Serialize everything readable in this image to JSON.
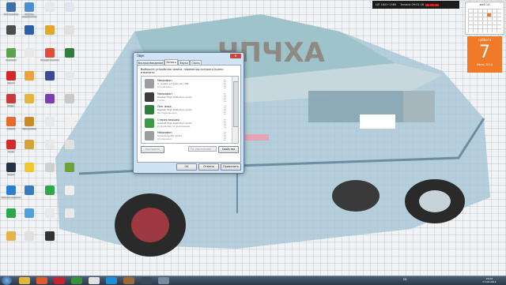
{
  "desktop_icons": [
    {
      "label": "Компьютер",
      "color": "#3d6fa8"
    },
    {
      "label": "Панель управления",
      "color": "#4a8fd0"
    },
    {
      "label": "",
      "color": "#e8e8e8"
    },
    {
      "label": "",
      "color": "#dfe6ee"
    },
    {
      "label": "",
      "color": "#4d4d4d"
    },
    {
      "label": "",
      "color": "#2d5fa8"
    },
    {
      "label": "",
      "color": "#e2a62a"
    },
    {
      "label": "",
      "color": "#e0e0e0"
    },
    {
      "label": "Корзина",
      "color": "#5aa54a"
    },
    {
      "label": "",
      "color": "#e8e8e8"
    },
    {
      "label": "Google Chrome",
      "color": "#e04b3b"
    },
    {
      "label": "",
      "color": "#2f7d3a"
    },
    {
      "label": "Opera",
      "color": "#d42727"
    },
    {
      "label": "",
      "color": "#e8a43b"
    },
    {
      "label": "",
      "color": "#3a4a9a"
    },
    {
      "label": "",
      "color": "#e8e8e8"
    },
    {
      "label": "Magic",
      "color": "#c93a3a"
    },
    {
      "label": "",
      "color": "#e6b33c"
    },
    {
      "label": "",
      "color": "#7d3db8"
    },
    {
      "label": "",
      "color": "#c9c9c9"
    },
    {
      "label": "Mozilla",
      "color": "#e46b2a"
    },
    {
      "label": "Программа",
      "color": "#c98a2a"
    },
    {
      "label": "",
      "color": "#e8e8e8"
    },
    {
      "label": "",
      "color": "#f0f0f0"
    },
    {
      "label": "Avast",
      "color": "#d42b2b"
    },
    {
      "label": "",
      "color": "#d8a437"
    },
    {
      "label": "",
      "color": "#e8e8e8"
    },
    {
      "label": "",
      "color": "#e0e0e0"
    },
    {
      "label": "Steam",
      "color": "#253445"
    },
    {
      "label": "",
      "color": "#f2c72c"
    },
    {
      "label": "",
      "color": "#cfcfcf"
    },
    {
      "label": "",
      "color": "#6aa43a"
    },
    {
      "label": "Internet Explorer",
      "color": "#2a7ed1"
    },
    {
      "label": "",
      "color": "#3a7abf"
    },
    {
      "label": "",
      "color": "#2fa84a"
    },
    {
      "label": "",
      "color": "#eeeeee"
    },
    {
      "label": "",
      "color": "#2aa84a"
    },
    {
      "label": "",
      "color": "#55a0d8"
    },
    {
      "label": "",
      "color": "#e8e8e8"
    },
    {
      "label": "",
      "color": "#e8e8e8"
    },
    {
      "label": "",
      "color": "#e4b448"
    },
    {
      "label": "",
      "color": "#e0e0e0"
    },
    {
      "label": "",
      "color": "#333333"
    }
  ],
  "gadgets": {
    "meters": {
      "cpu": "ЦП 18/0+1560",
      "mem": "Записи 09:01:18"
    },
    "mini_calendar": {
      "header": "май 14"
    },
    "big_calendar": {
      "day_name": "суббота",
      "day": "7",
      "month_year": "Июнь 2014"
    }
  },
  "dialog": {
    "title": "Звук",
    "tabs": [
      "Воспроизведение",
      "Запись",
      "Звуки",
      "Связь"
    ],
    "active_tab": "Запись",
    "instruction": "Выберите устройство записи, параметры которого нужно изменить:",
    "devices": [
      {
        "name": "Микрофон",
        "driver": "2- Аудио устройство USB",
        "status": "Отключено",
        "color": "#9e9e9e"
      },
      {
        "name": "Микрофон",
        "driver": "Realtek High Definition Audio",
        "status": "Готов",
        "color": "#3d3d3d"
      },
      {
        "name": "Лин. вход",
        "driver": "Realtek High Definition Audio",
        "status": "Не подключено",
        "color": "#2f7d3a"
      },
      {
        "name": "Стерео микшер",
        "driver": "Realtek High Definition Audio",
        "status": "Устройство по умолчанию",
        "color": "#3a9a45"
      },
      {
        "name": "Микрофон",
        "driver": "Sonicsting Mic audio",
        "status": "Отключено",
        "color": "#9e9e9e"
      }
    ],
    "configure_label": "Настроить",
    "default_select": "По умолчанию",
    "properties_label": "Свойства",
    "ok_label": "OK",
    "cancel_label": "Отмена",
    "apply_label": "Применить"
  },
  "taskbar": {
    "apps": [
      {
        "name": "explorer",
        "color": "#e3b53a"
      },
      {
        "name": "media",
        "color": "#e05a2a"
      },
      {
        "name": "opera",
        "color": "#c8222a"
      },
      {
        "name": "chrome",
        "color": "#3a8f3a"
      },
      {
        "name": "yandex",
        "color": "#e0e0e0"
      },
      {
        "name": "skype",
        "color": "#1e8fd6"
      },
      {
        "name": "photo",
        "color": "#9a6a3a"
      },
      {
        "name": "camera",
        "color": "#3a4a5a"
      },
      {
        "name": "sound",
        "color": "#7a8aa0"
      }
    ],
    "tray": "EN",
    "time": "22:02",
    "date": "07.06.2014"
  }
}
